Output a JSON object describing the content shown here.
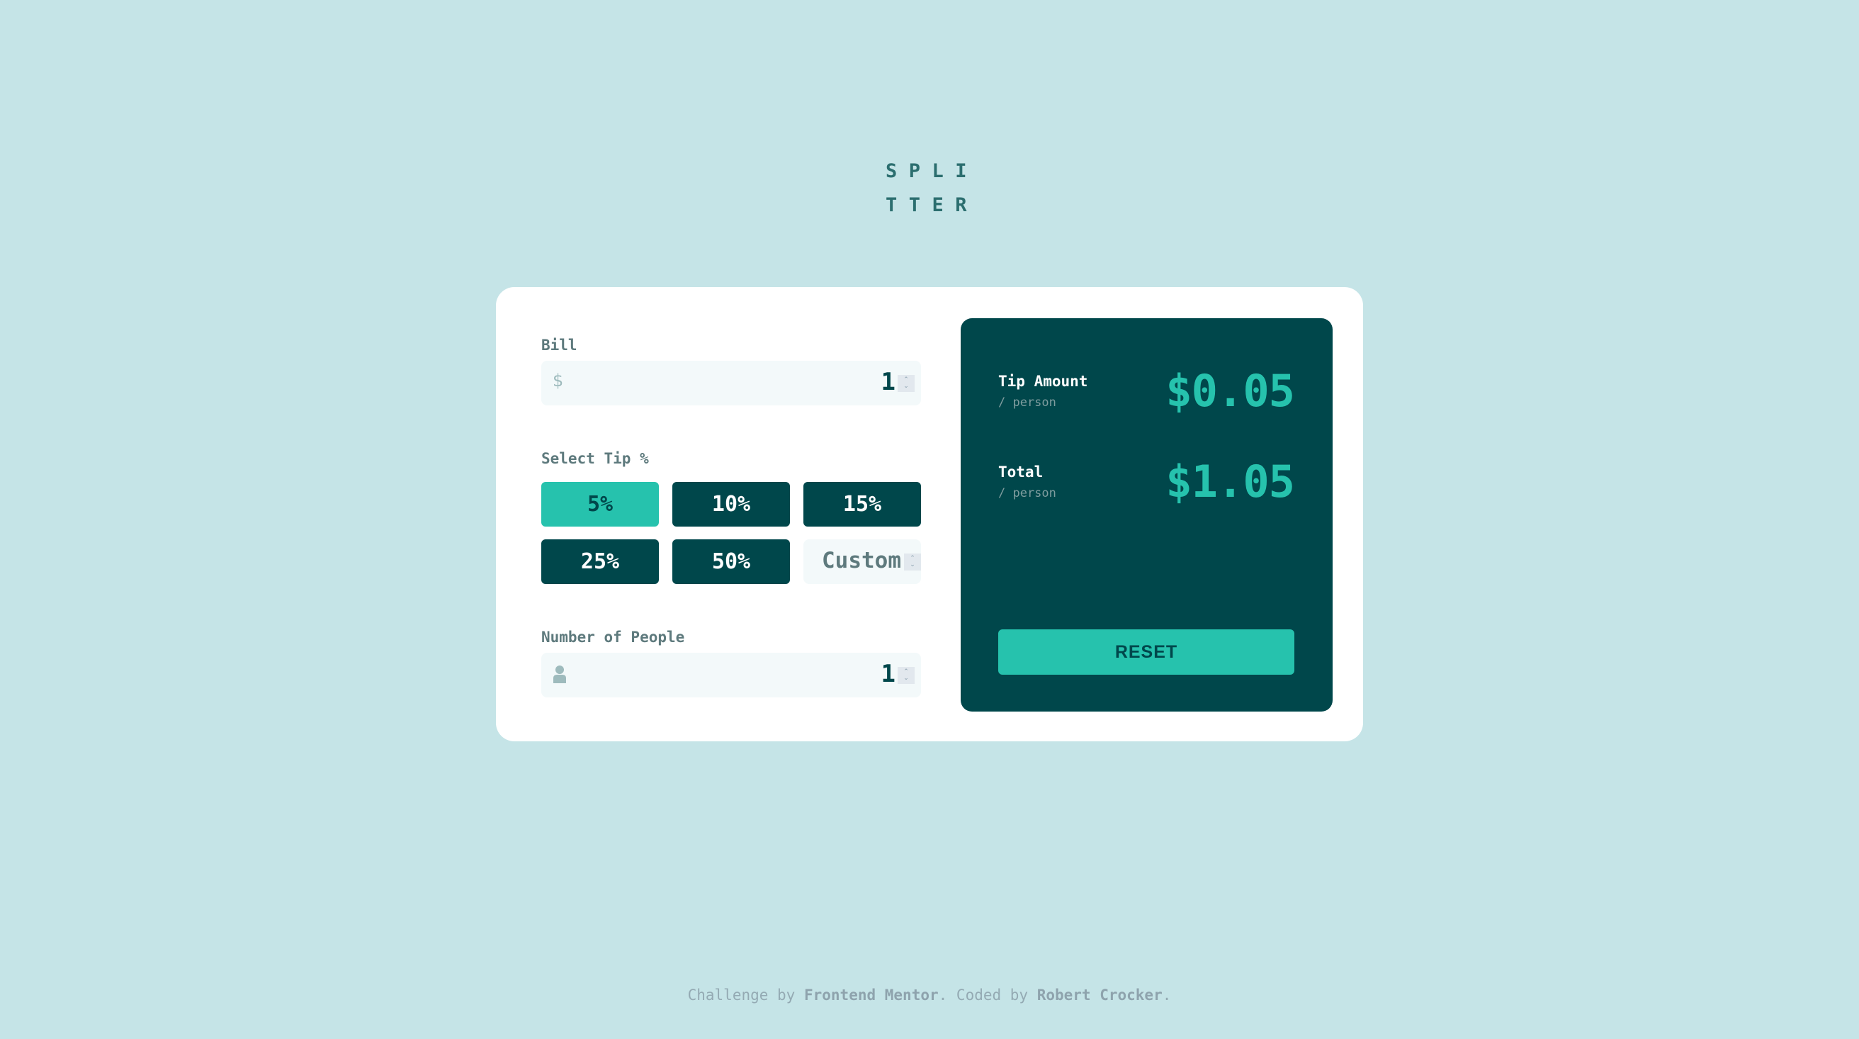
{
  "app": {
    "logo_lines": [
      "SPLI",
      "TTER"
    ]
  },
  "colors": {
    "background": "#c5e4e7",
    "card": "#ffffff",
    "dark_cyan": "#00474b",
    "strong_cyan": "#26c2ad",
    "label_grey": "#5e7a7d",
    "input_bg": "#f3f9fa"
  },
  "calculator": {
    "bill": {
      "label": "Bill",
      "prefix_icon": "dollar-icon",
      "prefix_symbol": "$",
      "value": "1"
    },
    "tip": {
      "label": "Select Tip %",
      "options": [
        {
          "label": "5%",
          "selected": true
        },
        {
          "label": "10%",
          "selected": false
        },
        {
          "label": "15%",
          "selected": false
        },
        {
          "label": "25%",
          "selected": false
        },
        {
          "label": "50%",
          "selected": false
        }
      ],
      "custom_placeholder": "Custom"
    },
    "people": {
      "label": "Number of People",
      "prefix_icon": "person-icon",
      "value": "1"
    },
    "spinner": {
      "up": "⌃",
      "down": "⌄"
    }
  },
  "results": {
    "tip_amount": {
      "label": "Tip Amount",
      "sub": "/ person",
      "value": "$0.05"
    },
    "total": {
      "label": "Total",
      "sub": "/ person",
      "value": "$1.05"
    },
    "reset_label": "RESET"
  },
  "footer": {
    "prefix": "Challenge by ",
    "link1": "Frontend Mentor",
    "middle": ". Coded by ",
    "link2": "Robert Crocker",
    "suffix": "."
  }
}
